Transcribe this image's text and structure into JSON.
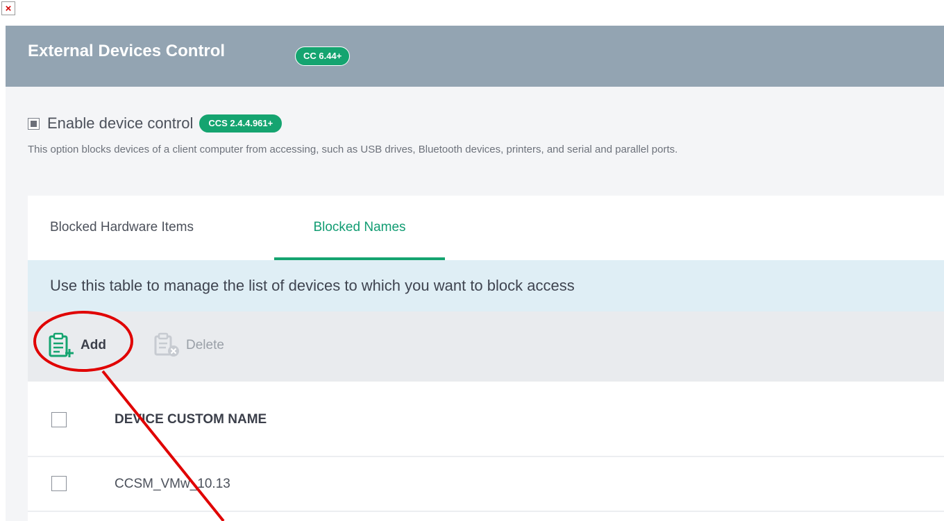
{
  "window": {
    "close_glyph": "×"
  },
  "header": {
    "title": "External Devices Control",
    "version_badge": "CC 6.44+",
    "background": "#93a4b2"
  },
  "device_control": {
    "checkbox_label": "Enable device control",
    "checkbox_state": "indeterminate",
    "version_badge": "CCS 2.4.4.961+",
    "description": "This option blocks devices of a client computer from accessing, such as USB drives, Bluetooth devices, printers, and serial and parallel ports."
  },
  "tabs": [
    {
      "label": "Blocked Hardware Items",
      "active": false
    },
    {
      "label": "Blocked Names",
      "active": true
    }
  ],
  "info_bar": {
    "text": "Use this table to manage the list of devices to which you want to block access"
  },
  "toolbar": {
    "add_label": "Add",
    "add_icon": "clipboard-add-icon",
    "delete_label": "Delete",
    "delete_icon": "clipboard-delete-icon",
    "delete_enabled": false
  },
  "table": {
    "columns": [
      "DEVICE CUSTOM NAME"
    ],
    "rows": [
      {
        "device_custom_name": "CCSM_VMw_10.13"
      }
    ]
  },
  "colors": {
    "accent": "#15a470",
    "annotation": "#e00000",
    "info_bar_bg": "#dfeef5",
    "toolbar_bg": "#e9ebee"
  }
}
